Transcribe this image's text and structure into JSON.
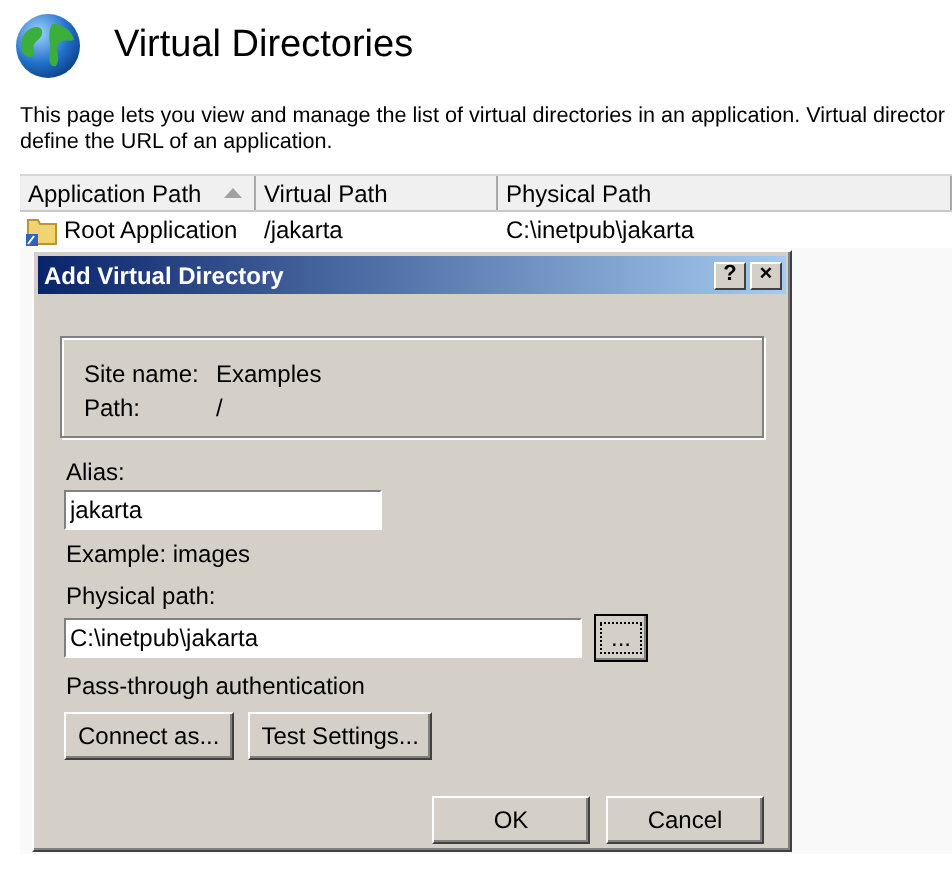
{
  "page": {
    "title": "Virtual Directories",
    "description_lines": [
      "This page lets you view and manage the list of virtual directories in an application. Virtual director",
      "define the URL of an application."
    ]
  },
  "table": {
    "columns": [
      {
        "label": "Application Path",
        "sorted": true
      },
      {
        "label": "Virtual Path",
        "sorted": false
      },
      {
        "label": "Physical Path",
        "sorted": false
      }
    ],
    "rows": [
      [
        "Root Application",
        "/jakarta",
        "C:\\inetpub\\jakarta"
      ]
    ]
  },
  "dialog": {
    "title": "Add Virtual Directory",
    "help_button": "?",
    "close_button": "×",
    "info": [
      {
        "label": "Site name:",
        "value": "Examples"
      },
      {
        "label": "Path:",
        "value": "/"
      }
    ],
    "alias": {
      "label": "Alias:",
      "value": "jakarta",
      "hint": "Example: images"
    },
    "physical_path": {
      "label": "Physical path:",
      "value": "C:\\inetpub\\jakarta",
      "browse_button": "..."
    },
    "auth_label": "Pass-through authentication",
    "auth_buttons": [
      "Connect as...",
      "Test Settings..."
    ],
    "buttons": [
      "OK",
      "Cancel"
    ]
  }
}
